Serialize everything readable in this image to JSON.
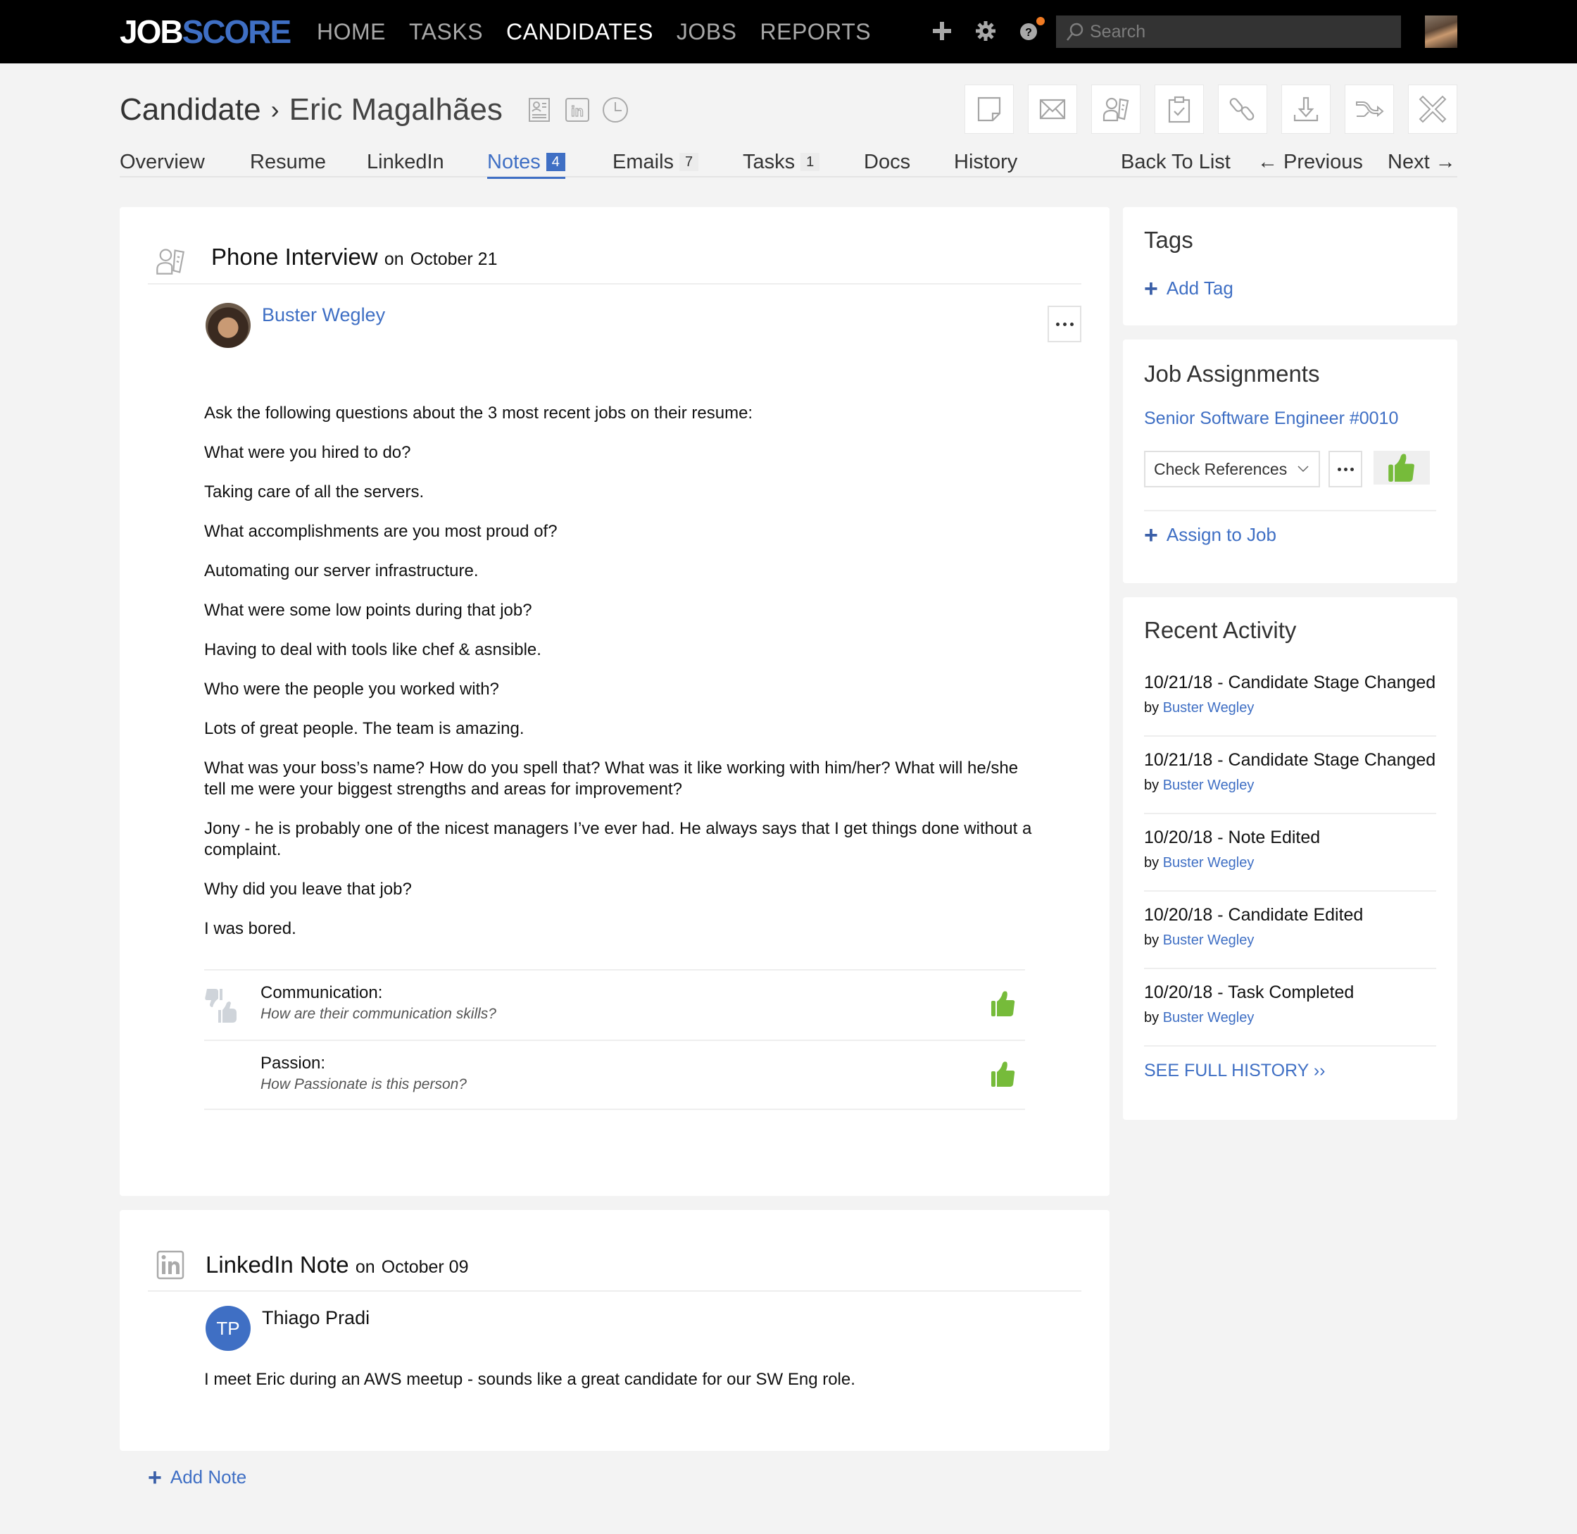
{
  "topnav": {
    "logo_part1": "JOB",
    "logo_part2": "SCORE",
    "items": [
      {
        "label": "HOME",
        "active": false
      },
      {
        "label": "TASKS",
        "active": false
      },
      {
        "label": "CANDIDATES",
        "active": true
      },
      {
        "label": "JOBS",
        "active": false
      },
      {
        "label": "REPORTS",
        "active": false
      }
    ],
    "icons": [
      "plus-icon",
      "gear-icon",
      "help-icon"
    ],
    "search_placeholder": "Search",
    "notification_color": "#f07a22"
  },
  "header": {
    "breadcrumb_root": "Candidate",
    "separator": "›",
    "candidate_name": "Eric Magalhães",
    "title_icons": [
      "resume-icon",
      "linkedin-icon",
      "clock-icon"
    ],
    "actions": [
      "add-note",
      "send-email",
      "schedule-interview",
      "add-task",
      "link",
      "download",
      "share",
      "reject"
    ]
  },
  "tabs": [
    {
      "label": "Overview"
    },
    {
      "label": "Resume"
    },
    {
      "label": "LinkedIn"
    },
    {
      "label": "Notes",
      "badge": "4",
      "active": true
    },
    {
      "label": "Emails",
      "badge": "7"
    },
    {
      "label": "Tasks",
      "badge": "1"
    },
    {
      "label": "Docs"
    },
    {
      "label": "History"
    }
  ],
  "pager": {
    "back": "Back To List",
    "previous": "← Previous",
    "next": "Next →"
  },
  "notes": [
    {
      "type": "Phone Interview",
      "date_prefix": "on",
      "date": "October 21",
      "author": "Buster Wegley",
      "paragraphs": [
        "Ask the following questions about the 3 most recent jobs on their resume:",
        "What were you hired to do?",
        "Taking care of all the servers.",
        "What accomplishments are you most proud of?",
        "Automating our server infrastructure.",
        "What were some low points during that job?",
        "Having to deal with tools like chef & asnsible.",
        "Who were the people you worked with?",
        "Lots of great people. The team is amazing.",
        "What was your boss’s name?  How do you spell that?  What was it like working with him/her?  What will he/she tell me were your biggest strengths and areas for improvement?",
        "Jony - he is probably one of the nicest managers I’ve ever had. He always says that I get things done without a complaint.",
        "Why did you leave that job?",
        "I was bored."
      ],
      "scorecard": [
        {
          "label": "Communication:",
          "hint": "How are their communication skills?",
          "rating": "thumbs-up"
        },
        {
          "label": "Passion:",
          "hint": "How Passionate is this person?",
          "rating": "thumbs-up"
        }
      ]
    },
    {
      "type": "LinkedIn Note",
      "date_prefix": "on",
      "date": "October 09",
      "author": "Thiago Pradi",
      "author_initials": "TP",
      "paragraphs": [
        "I meet Eric during an AWS meetup - sounds like a great candidate for our SW Eng role."
      ]
    }
  ],
  "add_note": "Add Note",
  "sidebar": {
    "tags": {
      "title": "Tags",
      "add_label": "Add Tag"
    },
    "jobs": {
      "title": "Job Assignments",
      "job_link": "Senior Software Engineer #0010",
      "stage": "Check References",
      "assign_label": "Assign to Job"
    },
    "activity": {
      "title": "Recent Activity",
      "by_prefix": "by",
      "items": [
        {
          "title": "10/21/18 - Candidate Stage Changed",
          "by": "Buster Wegley"
        },
        {
          "title": "10/21/18 - Candidate Stage Changed",
          "by": "Buster Wegley"
        },
        {
          "title": "10/20/18 - Note Edited",
          "by": "Buster Wegley"
        },
        {
          "title": "10/20/18 - Candidate Edited",
          "by": "Buster Wegley"
        },
        {
          "title": "10/20/18 - Task Completed",
          "by": "Buster Wegley"
        }
      ],
      "see_full": "SEE FULL HISTORY ››"
    }
  },
  "colors": {
    "accent": "#3f6fc4",
    "thumb_green": "#76bb3a",
    "background": "#f3f3f3"
  }
}
